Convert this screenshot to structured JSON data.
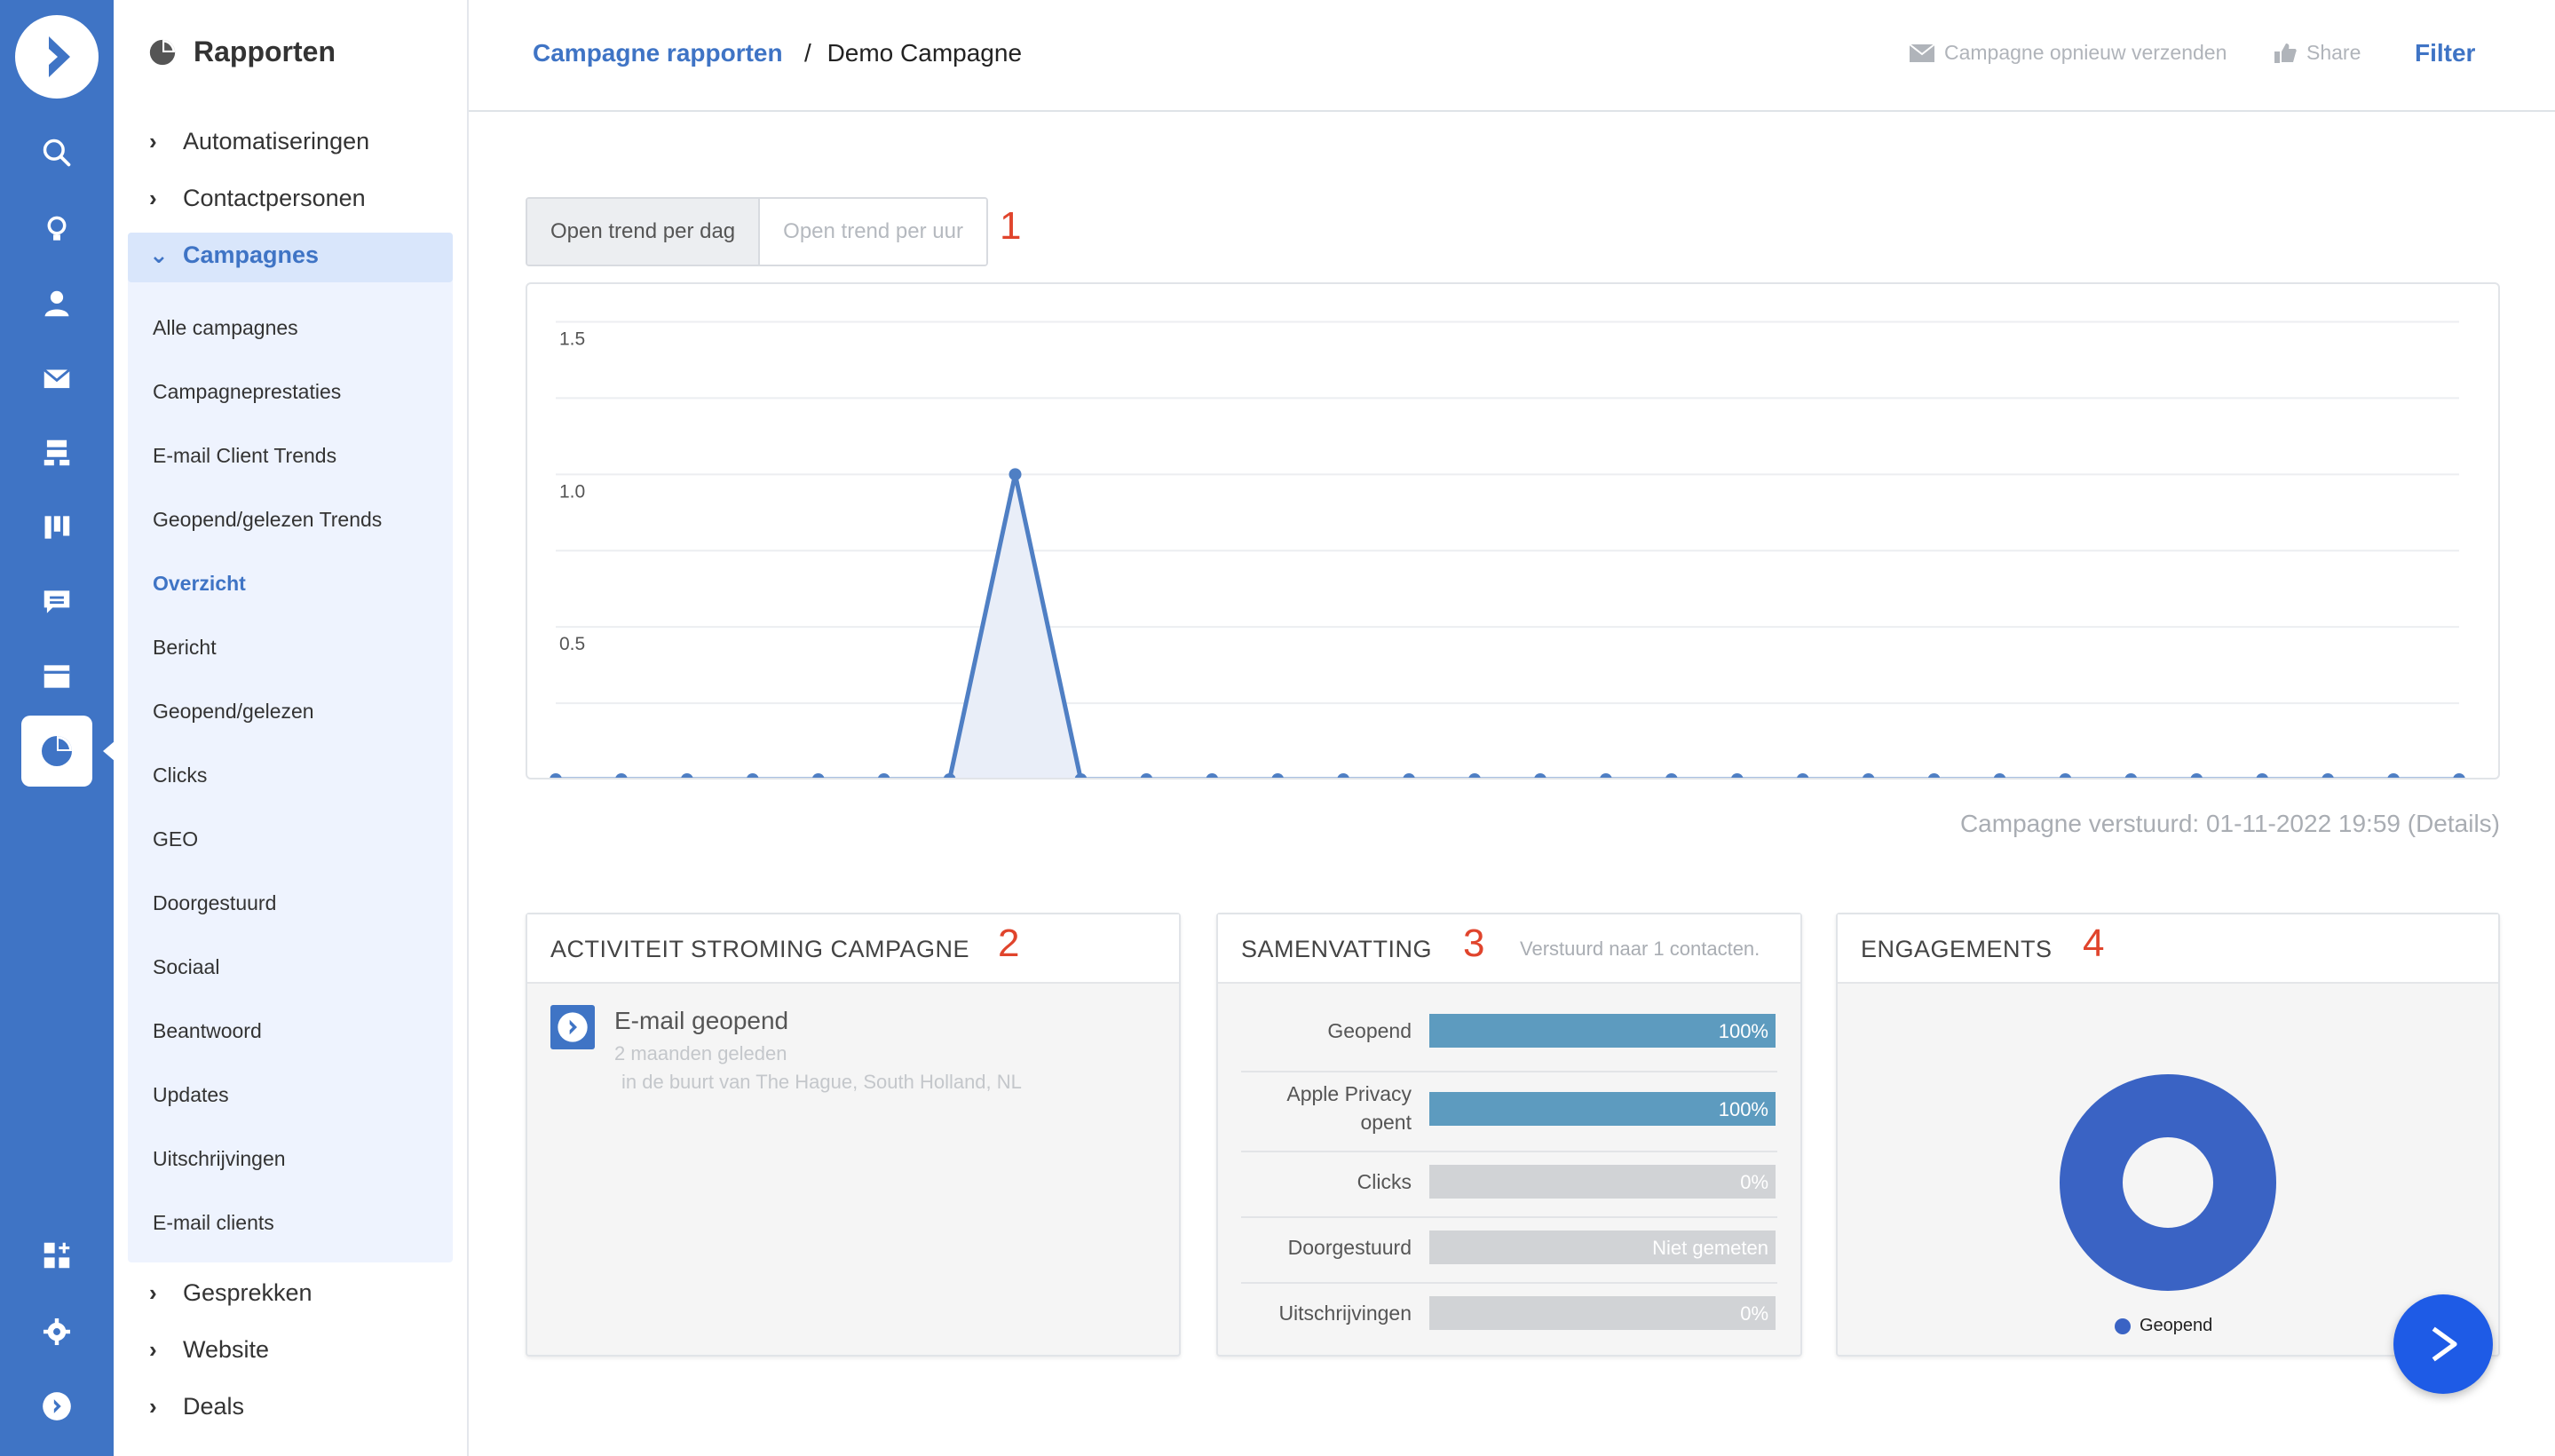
{
  "nav": {
    "title": "Rapporten",
    "groups": [
      "Automatiseringen",
      "Contactpersonen",
      "Campagnes",
      "Gesprekken",
      "Website",
      "Deals"
    ],
    "campaign_items": [
      "Alle campagnes",
      "Campagneprestaties",
      "E-mail Client Trends",
      "Geopend/gelezen Trends",
      "Overzicht",
      "Bericht",
      "Geopend/gelezen",
      "Clicks",
      "GEO",
      "Doorgestuurd",
      "Sociaal",
      "Beantwoord",
      "Updates",
      "Uitschrijvingen",
      "E-mail clients"
    ],
    "active_item": "Overzicht"
  },
  "header": {
    "crumb_parent": "Campagne rapporten",
    "crumb_sep": "/",
    "crumb_current": "Demo Campagne",
    "resend": "Campagne opnieuw verzenden",
    "share": "Share",
    "filter": "Filter"
  },
  "tabs": {
    "day": "Open trend per dag",
    "hour": "Open trend per uur"
  },
  "annotations": [
    "1",
    "2",
    "3",
    "4"
  ],
  "chart_data": {
    "type": "area",
    "y_ticks": [
      "1.5",
      "1.0",
      "0.5"
    ],
    "ylim": [
      0,
      1.5
    ],
    "values": [
      0,
      0,
      0,
      0,
      0,
      0,
      0,
      1,
      0,
      0,
      0,
      0,
      0,
      0,
      0,
      0,
      0,
      0,
      0,
      0,
      0,
      0,
      0,
      0,
      0,
      0,
      0,
      0,
      0,
      0
    ],
    "colors": {
      "line": "#4f7fc4",
      "fill": "#e9eef8",
      "grid": "#eceef1"
    }
  },
  "sent_text": "Campagne verstuurd: 01-11-2022 19:59 (Details)",
  "activity": {
    "title": "ACTIVITEIT STROMING CAMPAGNE",
    "event": "E-mail geopend",
    "time": "2 maanden geleden",
    "location": "in de buurt van The Hague, South Holland, NL"
  },
  "summary": {
    "title": "SAMENVATTING",
    "sent_to": "Verstuurd naar 1 contacten.",
    "rows": [
      {
        "label": "Geopend",
        "value": "100%",
        "fraction": 1
      },
      {
        "label": "Apple Privacy opent",
        "value": "100%",
        "fraction": 1
      },
      {
        "label": "Clicks",
        "value": "0%",
        "fraction": 0
      },
      {
        "label": "Doorgestuurd",
        "value": "Niet gemeten",
        "fraction": 0
      },
      {
        "label": "Uitschrijvingen",
        "value": "0%",
        "fraction": 0
      }
    ]
  },
  "engagements": {
    "title": "ENGAGEMENTS",
    "legend": "Geopend",
    "opened_fraction": 1,
    "color": "#3a63c4"
  }
}
